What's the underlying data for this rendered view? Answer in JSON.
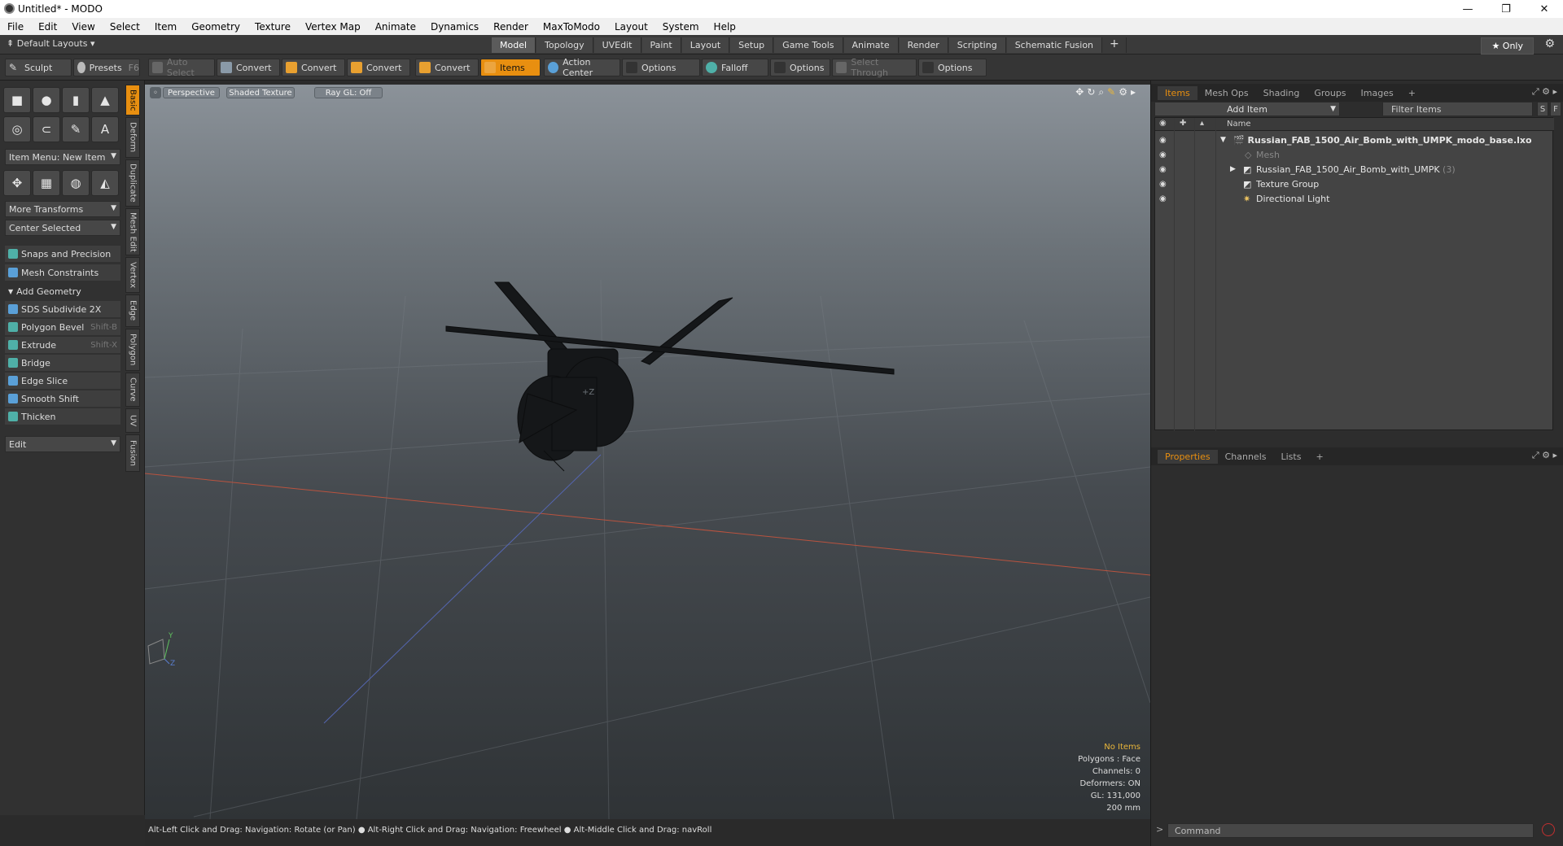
{
  "window": {
    "title": "Untitled* - MODO",
    "minimize": "—",
    "maximize": "❐",
    "close": "✕"
  },
  "menu": [
    "File",
    "Edit",
    "View",
    "Select",
    "Item",
    "Geometry",
    "Texture",
    "Vertex Map",
    "Animate",
    "Dynamics",
    "Render",
    "MaxToModo",
    "Layout",
    "System",
    "Help"
  ],
  "modebar": {
    "layouts": "Default Layouts ▾",
    "tabs": [
      "Model",
      "Topology",
      "UVEdit",
      "Paint",
      "Layout",
      "Setup",
      "Game Tools",
      "Animate",
      "Render",
      "Scripting",
      "Schematic Fusion"
    ],
    "active_tab": "Model",
    "add": "+",
    "only": "★ Only"
  },
  "toolbar": {
    "sculpt": "Sculpt",
    "presets": "Presets",
    "presets_key": "F6",
    "auto_select": "Auto Select",
    "convert1": "Convert",
    "convert2": "Convert",
    "convert3": "Convert",
    "convert4": "Convert",
    "items": "Items",
    "action_center": "Action Center",
    "options1": "Options",
    "falloff": "Falloff",
    "options2": "Options",
    "select_through": "Select Through",
    "options3": "Options"
  },
  "left": {
    "item_menu": "Item Menu: New Item",
    "more_transforms": "More Transforms",
    "center_selected": "Center Selected",
    "snaps": "Snaps and Precision",
    "mesh_constraints": "Mesh Constraints",
    "add_geometry": "Add Geometry",
    "tools": [
      {
        "label": "SDS Subdivide 2X",
        "key": ""
      },
      {
        "label": "Polygon Bevel",
        "key": "Shift-B"
      },
      {
        "label": "Extrude",
        "key": "Shift-X"
      },
      {
        "label": "Bridge",
        "key": ""
      },
      {
        "label": "Edge Slice",
        "key": ""
      },
      {
        "label": "Smooth Shift",
        "key": ""
      },
      {
        "label": "Thicken",
        "key": ""
      }
    ],
    "edit": "Edit",
    "vtabs": [
      "Basic",
      "Deform",
      "Duplicate",
      "Mesh Edit",
      "Vertex",
      "Edge",
      "Polygon",
      "Curve",
      "UV",
      "Fusion"
    ]
  },
  "viewport": {
    "perspective": "Perspective",
    "shaded": "Shaded Texture",
    "raygl": "Ray GL: Off",
    "hud": {
      "no_items": "No Items",
      "polygons": "Polygons : Face",
      "channels": "Channels: 0",
      "deformers": "Deformers: ON",
      "gl": "GL: 131,000",
      "scale": "200 mm"
    },
    "axis_label": "+Z"
  },
  "status": "Alt-Left Click and Drag: Navigation: Rotate (or Pan) ● Alt-Right Click and Drag: Navigation: Freewheel ● Alt-Middle Click and Drag: navRoll",
  "right": {
    "tabs": [
      "Items",
      "Mesh Ops",
      "Shading",
      "Groups",
      "Images",
      "+"
    ],
    "add_item": "Add Item",
    "filter": "Filter Items",
    "s": "S",
    "f": "F",
    "col_name": "Name",
    "rows": [
      {
        "label": "Russian_FAB_1500_Air_Bomb_with_UMPK_modo_base.lxo",
        "bold": true,
        "indent": 0,
        "arrow": "▼"
      },
      {
        "label": "Mesh",
        "dim": true,
        "indent": 2,
        "arrow": ""
      },
      {
        "label": "Russian_FAB_1500_Air_Bomb_with_UMPK",
        "count": "(3)",
        "indent": 1,
        "arrow": "▶"
      },
      {
        "label": "Texture Group",
        "indent": 1,
        "arrow": ""
      },
      {
        "label": "Directional Light",
        "indent": 1,
        "arrow": ""
      }
    ],
    "props_tabs": [
      "Properties",
      "Channels",
      "Lists",
      "+"
    ],
    "command_placeholder": "Command"
  }
}
